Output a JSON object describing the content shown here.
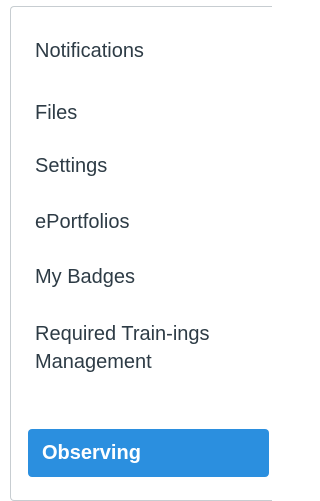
{
  "nav": {
    "items": [
      {
        "label": "Notifications"
      },
      {
        "label": "Files"
      },
      {
        "label": "Settings"
      },
      {
        "label": "ePortfolios"
      },
      {
        "label": "My Badges"
      },
      {
        "label": "Required Train-ings Management"
      },
      {
        "label": "Observing",
        "active": true
      }
    ]
  },
  "colors": {
    "text": "#2d3b45",
    "active_background": "#2b8fdf",
    "active_text": "#ffffff",
    "border": "#c7cdd1"
  }
}
